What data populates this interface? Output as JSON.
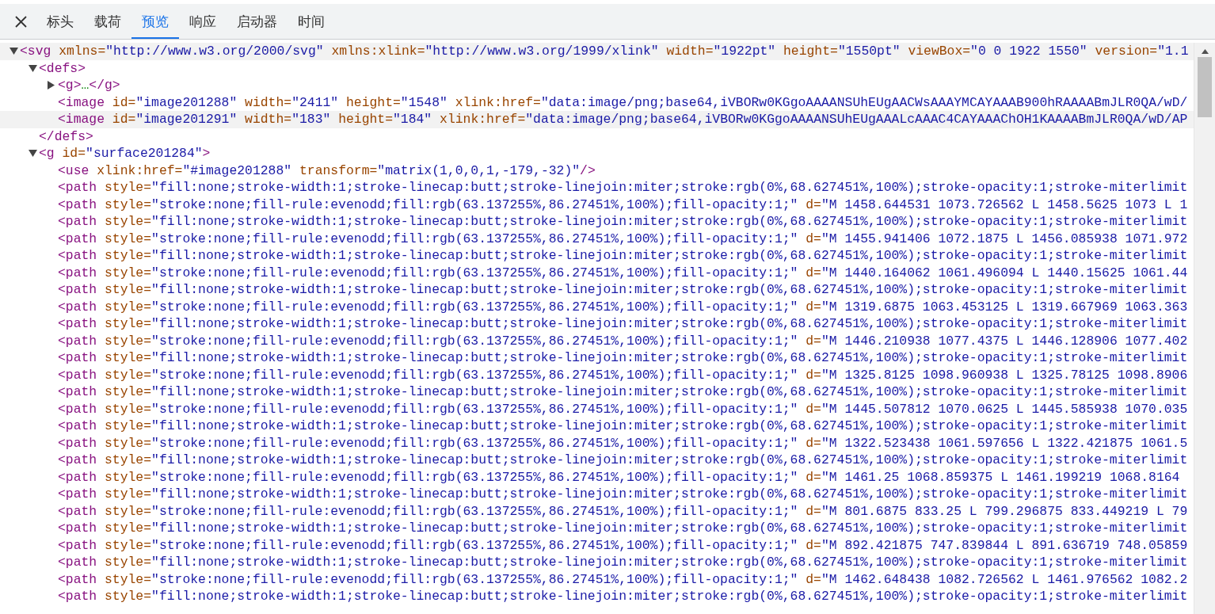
{
  "tabs": [
    {
      "label": "标头",
      "selected": false
    },
    {
      "label": "载荷",
      "selected": false
    },
    {
      "label": "预览",
      "selected": true
    },
    {
      "label": "响应",
      "selected": false
    },
    {
      "label": "启动器",
      "selected": false
    },
    {
      "label": "时间",
      "selected": false
    }
  ],
  "tree": [
    {
      "expanded": true,
      "highlighted": true,
      "tokens": [
        {
          "kind": "tag",
          "text": "<svg"
        },
        {
          "kind": "attr",
          "text": " xmlns="
        },
        {
          "kind": "value",
          "text": "\"http://www.w3.org/2000/svg\""
        },
        {
          "kind": "attr",
          "text": " xmlns:xlink="
        },
        {
          "kind": "value",
          "text": "\"http://www.w3.org/1999/xlink\""
        },
        {
          "kind": "attr",
          "text": " width="
        },
        {
          "kind": "value",
          "text": "\"1922pt\""
        },
        {
          "kind": "attr",
          "text": " height="
        },
        {
          "kind": "value",
          "text": "\"1550pt\""
        },
        {
          "kind": "attr",
          "text": " viewBox="
        },
        {
          "kind": "value",
          "text": "\"0 0 1922 1550\""
        },
        {
          "kind": "attr",
          "text": " version="
        },
        {
          "kind": "value",
          "text": "\"1.1"
        }
      ],
      "children": [
        {
          "expanded": true,
          "highlighted": false,
          "tokens": [
            {
              "kind": "tag",
              "text": "<defs>"
            }
          ],
          "close": [
            {
              "kind": "tag",
              "text": "</defs>"
            }
          ],
          "children": [
            {
              "expanded": false,
              "highlighted": false,
              "tokens": [
                {
                  "kind": "tag",
                  "text": "<g>"
                },
                {
                  "kind": "ellipsis",
                  "text": "…"
                },
                {
                  "kind": "tag",
                  "text": "</g>"
                }
              ]
            },
            {
              "highlighted": false,
              "tokens": [
                {
                  "kind": "tag",
                  "text": "<image"
                },
                {
                  "kind": "attr",
                  "text": " id="
                },
                {
                  "kind": "value",
                  "text": "\"image201288\""
                },
                {
                  "kind": "attr",
                  "text": " width="
                },
                {
                  "kind": "value",
                  "text": "\"2411\""
                },
                {
                  "kind": "attr",
                  "text": " height="
                },
                {
                  "kind": "value",
                  "text": "\"1548\""
                },
                {
                  "kind": "attr",
                  "text": " xlink:href="
                },
                {
                  "kind": "value",
                  "text": "\"data:image/png;base64,iVBORw0KGgoAAAANSUhEUgAACWsAAAYMCAYAAAB900hRAAAABmJLR0QA/wD/"
                }
              ]
            },
            {
              "highlighted": true,
              "tokens": [
                {
                  "kind": "tag",
                  "text": "<image"
                },
                {
                  "kind": "attr",
                  "text": " id="
                },
                {
                  "kind": "value",
                  "text": "\"image201291\""
                },
                {
                  "kind": "attr",
                  "text": " width="
                },
                {
                  "kind": "value",
                  "text": "\"183\""
                },
                {
                  "kind": "attr",
                  "text": " height="
                },
                {
                  "kind": "value",
                  "text": "\"184\""
                },
                {
                  "kind": "attr",
                  "text": " xlink:href="
                },
                {
                  "kind": "value",
                  "text": "\"data:image/png;base64,iVBORw0KGgoAAAANSUhEUgAAALcAAAC4CAYAAAChOH1KAAAABmJLR0QA/wD/AP"
                }
              ]
            }
          ]
        },
        {
          "expanded": true,
          "highlighted": false,
          "tokens": [
            {
              "kind": "tag",
              "text": "<g"
            },
            {
              "kind": "attr",
              "text": " id="
            },
            {
              "kind": "value",
              "text": "\"surface201284\""
            },
            {
              "kind": "tag",
              "text": ">"
            }
          ],
          "children": [
            {
              "highlighted": false,
              "tokens": [
                {
                  "kind": "tag",
                  "text": "<use"
                },
                {
                  "kind": "attr",
                  "text": " xlink:href="
                },
                {
                  "kind": "value",
                  "text": "\"#image201288\""
                },
                {
                  "kind": "attr",
                  "text": " transform="
                },
                {
                  "kind": "value",
                  "text": "\"matrix(1,0,0,1,-179,-32)\""
                },
                {
                  "kind": "tag",
                  "text": "/>"
                }
              ]
            },
            {
              "highlighted": false,
              "tokens": [
                {
                  "kind": "tag",
                  "text": "<path"
                },
                {
                  "kind": "attr",
                  "text": " style="
                },
                {
                  "kind": "value",
                  "text": "\"fill:none;stroke-width:1;stroke-linecap:butt;stroke-linejoin:miter;stroke:rgb(0%,68.627451%,100%);stroke-opacity:1;stroke-miterlimit"
                }
              ]
            },
            {
              "highlighted": false,
              "tokens": [
                {
                  "kind": "tag",
                  "text": "<path"
                },
                {
                  "kind": "attr",
                  "text": " style="
                },
                {
                  "kind": "value",
                  "text": "\"stroke:none;fill-rule:evenodd;fill:rgb(63.137255%,86.27451%,100%);fill-opacity:1;\""
                },
                {
                  "kind": "attr",
                  "text": " d="
                },
                {
                  "kind": "value",
                  "text": "\"M 1458.644531 1073.726562 L 1458.5625 1073 L 1"
                }
              ]
            },
            {
              "highlighted": false,
              "tokens": [
                {
                  "kind": "tag",
                  "text": "<path"
                },
                {
                  "kind": "attr",
                  "text": " style="
                },
                {
                  "kind": "value",
                  "text": "\"fill:none;stroke-width:1;stroke-linecap:butt;stroke-linejoin:miter;stroke:rgb(0%,68.627451%,100%);stroke-opacity:1;stroke-miterlimit"
                }
              ]
            },
            {
              "highlighted": false,
              "tokens": [
                {
                  "kind": "tag",
                  "text": "<path"
                },
                {
                  "kind": "attr",
                  "text": " style="
                },
                {
                  "kind": "value",
                  "text": "\"stroke:none;fill-rule:evenodd;fill:rgb(63.137255%,86.27451%,100%);fill-opacity:1;\""
                },
                {
                  "kind": "attr",
                  "text": " d="
                },
                {
                  "kind": "value",
                  "text": "\"M 1455.941406 1072.1875 L 1456.085938 1071.972"
                }
              ]
            },
            {
              "highlighted": false,
              "tokens": [
                {
                  "kind": "tag",
                  "text": "<path"
                },
                {
                  "kind": "attr",
                  "text": " style="
                },
                {
                  "kind": "value",
                  "text": "\"fill:none;stroke-width:1;stroke-linecap:butt;stroke-linejoin:miter;stroke:rgb(0%,68.627451%,100%);stroke-opacity:1;stroke-miterlimit"
                }
              ]
            },
            {
              "highlighted": false,
              "tokens": [
                {
                  "kind": "tag",
                  "text": "<path"
                },
                {
                  "kind": "attr",
                  "text": " style="
                },
                {
                  "kind": "value",
                  "text": "\"stroke:none;fill-rule:evenodd;fill:rgb(63.137255%,86.27451%,100%);fill-opacity:1;\""
                },
                {
                  "kind": "attr",
                  "text": " d="
                },
                {
                  "kind": "value",
                  "text": "\"M 1440.164062 1061.496094 L 1440.15625 1061.44"
                }
              ]
            },
            {
              "highlighted": false,
              "tokens": [
                {
                  "kind": "tag",
                  "text": "<path"
                },
                {
                  "kind": "attr",
                  "text": " style="
                },
                {
                  "kind": "value",
                  "text": "\"fill:none;stroke-width:1;stroke-linecap:butt;stroke-linejoin:miter;stroke:rgb(0%,68.627451%,100%);stroke-opacity:1;stroke-miterlimit"
                }
              ]
            },
            {
              "highlighted": false,
              "tokens": [
                {
                  "kind": "tag",
                  "text": "<path"
                },
                {
                  "kind": "attr",
                  "text": " style="
                },
                {
                  "kind": "value",
                  "text": "\"stroke:none;fill-rule:evenodd;fill:rgb(63.137255%,86.27451%,100%);fill-opacity:1;\""
                },
                {
                  "kind": "attr",
                  "text": " d="
                },
                {
                  "kind": "value",
                  "text": "\"M 1319.6875 1063.453125 L 1319.667969 1063.363"
                }
              ]
            },
            {
              "highlighted": false,
              "tokens": [
                {
                  "kind": "tag",
                  "text": "<path"
                },
                {
                  "kind": "attr",
                  "text": " style="
                },
                {
                  "kind": "value",
                  "text": "\"fill:none;stroke-width:1;stroke-linecap:butt;stroke-linejoin:miter;stroke:rgb(0%,68.627451%,100%);stroke-opacity:1;stroke-miterlimit"
                }
              ]
            },
            {
              "highlighted": false,
              "tokens": [
                {
                  "kind": "tag",
                  "text": "<path"
                },
                {
                  "kind": "attr",
                  "text": " style="
                },
                {
                  "kind": "value",
                  "text": "\"stroke:none;fill-rule:evenodd;fill:rgb(63.137255%,86.27451%,100%);fill-opacity:1;\""
                },
                {
                  "kind": "attr",
                  "text": " d="
                },
                {
                  "kind": "value",
                  "text": "\"M 1446.210938 1077.4375 L 1446.128906 1077.402"
                }
              ]
            },
            {
              "highlighted": false,
              "tokens": [
                {
                  "kind": "tag",
                  "text": "<path"
                },
                {
                  "kind": "attr",
                  "text": " style="
                },
                {
                  "kind": "value",
                  "text": "\"fill:none;stroke-width:1;stroke-linecap:butt;stroke-linejoin:miter;stroke:rgb(0%,68.627451%,100%);stroke-opacity:1;stroke-miterlimit"
                }
              ]
            },
            {
              "highlighted": false,
              "tokens": [
                {
                  "kind": "tag",
                  "text": "<path"
                },
                {
                  "kind": "attr",
                  "text": " style="
                },
                {
                  "kind": "value",
                  "text": "\"stroke:none;fill-rule:evenodd;fill:rgb(63.137255%,86.27451%,100%);fill-opacity:1;\""
                },
                {
                  "kind": "attr",
                  "text": " d="
                },
                {
                  "kind": "value",
                  "text": "\"M 1325.8125 1098.960938 L 1325.78125 1098.8906"
                }
              ]
            },
            {
              "highlighted": false,
              "tokens": [
                {
                  "kind": "tag",
                  "text": "<path"
                },
                {
                  "kind": "attr",
                  "text": " style="
                },
                {
                  "kind": "value",
                  "text": "\"fill:none;stroke-width:1;stroke-linecap:butt;stroke-linejoin:miter;stroke:rgb(0%,68.627451%,100%);stroke-opacity:1;stroke-miterlimit"
                }
              ]
            },
            {
              "highlighted": false,
              "tokens": [
                {
                  "kind": "tag",
                  "text": "<path"
                },
                {
                  "kind": "attr",
                  "text": " style="
                },
                {
                  "kind": "value",
                  "text": "\"stroke:none;fill-rule:evenodd;fill:rgb(63.137255%,86.27451%,100%);fill-opacity:1;\""
                },
                {
                  "kind": "attr",
                  "text": " d="
                },
                {
                  "kind": "value",
                  "text": "\"M 1445.507812 1070.0625 L 1445.585938 1070.035"
                }
              ]
            },
            {
              "highlighted": false,
              "tokens": [
                {
                  "kind": "tag",
                  "text": "<path"
                },
                {
                  "kind": "attr",
                  "text": " style="
                },
                {
                  "kind": "value",
                  "text": "\"fill:none;stroke-width:1;stroke-linecap:butt;stroke-linejoin:miter;stroke:rgb(0%,68.627451%,100%);stroke-opacity:1;stroke-miterlimit"
                }
              ]
            },
            {
              "highlighted": false,
              "tokens": [
                {
                  "kind": "tag",
                  "text": "<path"
                },
                {
                  "kind": "attr",
                  "text": " style="
                },
                {
                  "kind": "value",
                  "text": "\"stroke:none;fill-rule:evenodd;fill:rgb(63.137255%,86.27451%,100%);fill-opacity:1;\""
                },
                {
                  "kind": "attr",
                  "text": " d="
                },
                {
                  "kind": "value",
                  "text": "\"M 1322.523438 1061.597656 L 1322.421875 1061.5"
                }
              ]
            },
            {
              "highlighted": false,
              "tokens": [
                {
                  "kind": "tag",
                  "text": "<path"
                },
                {
                  "kind": "attr",
                  "text": " style="
                },
                {
                  "kind": "value",
                  "text": "\"fill:none;stroke-width:1;stroke-linecap:butt;stroke-linejoin:miter;stroke:rgb(0%,68.627451%,100%);stroke-opacity:1;stroke-miterlimit"
                }
              ]
            },
            {
              "highlighted": false,
              "tokens": [
                {
                  "kind": "tag",
                  "text": "<path"
                },
                {
                  "kind": "attr",
                  "text": " style="
                },
                {
                  "kind": "value",
                  "text": "\"stroke:none;fill-rule:evenodd;fill:rgb(63.137255%,86.27451%,100%);fill-opacity:1;\""
                },
                {
                  "kind": "attr",
                  "text": " d="
                },
                {
                  "kind": "value",
                  "text": "\"M 1461.25 1068.859375 L 1461.199219 1068.8164"
                }
              ]
            },
            {
              "highlighted": false,
              "tokens": [
                {
                  "kind": "tag",
                  "text": "<path"
                },
                {
                  "kind": "attr",
                  "text": " style="
                },
                {
                  "kind": "value",
                  "text": "\"fill:none;stroke-width:1;stroke-linecap:butt;stroke-linejoin:miter;stroke:rgb(0%,68.627451%,100%);stroke-opacity:1;stroke-miterlimit"
                }
              ]
            },
            {
              "highlighted": false,
              "tokens": [
                {
                  "kind": "tag",
                  "text": "<path"
                },
                {
                  "kind": "attr",
                  "text": " style="
                },
                {
                  "kind": "value",
                  "text": "\"stroke:none;fill-rule:evenodd;fill:rgb(63.137255%,86.27451%,100%);fill-opacity:1;\""
                },
                {
                  "kind": "attr",
                  "text": " d="
                },
                {
                  "kind": "value",
                  "text": "\"M 801.6875 833.25 L 799.296875 833.449219 L 79"
                }
              ]
            },
            {
              "highlighted": false,
              "tokens": [
                {
                  "kind": "tag",
                  "text": "<path"
                },
                {
                  "kind": "attr",
                  "text": " style="
                },
                {
                  "kind": "value",
                  "text": "\"fill:none;stroke-width:1;stroke-linecap:butt;stroke-linejoin:miter;stroke:rgb(0%,68.627451%,100%);stroke-opacity:1;stroke-miterlimit"
                }
              ]
            },
            {
              "highlighted": false,
              "tokens": [
                {
                  "kind": "tag",
                  "text": "<path"
                },
                {
                  "kind": "attr",
                  "text": " style="
                },
                {
                  "kind": "value",
                  "text": "\"stroke:none;fill-rule:evenodd;fill:rgb(63.137255%,86.27451%,100%);fill-opacity:1;\""
                },
                {
                  "kind": "attr",
                  "text": " d="
                },
                {
                  "kind": "value",
                  "text": "\"M 892.421875 747.839844 L 891.636719 748.05859"
                }
              ]
            },
            {
              "highlighted": false,
              "tokens": [
                {
                  "kind": "tag",
                  "text": "<path"
                },
                {
                  "kind": "attr",
                  "text": " style="
                },
                {
                  "kind": "value",
                  "text": "\"fill:none;stroke-width:1;stroke-linecap:butt;stroke-linejoin:miter;stroke:rgb(0%,68.627451%,100%);stroke-opacity:1;stroke-miterlimit"
                }
              ]
            },
            {
              "highlighted": false,
              "tokens": [
                {
                  "kind": "tag",
                  "text": "<path"
                },
                {
                  "kind": "attr",
                  "text": " style="
                },
                {
                  "kind": "value",
                  "text": "\"stroke:none;fill-rule:evenodd;fill:rgb(63.137255%,86.27451%,100%);fill-opacity:1;\""
                },
                {
                  "kind": "attr",
                  "text": " d="
                },
                {
                  "kind": "value",
                  "text": "\"M 1462.648438 1082.726562 L 1461.976562 1082.2"
                }
              ]
            },
            {
              "highlighted": false,
              "tokens": [
                {
                  "kind": "tag",
                  "text": "<path"
                },
                {
                  "kind": "attr",
                  "text": " style="
                },
                {
                  "kind": "value",
                  "text": "\"fill:none;stroke-width:1;stroke-linecap:butt;stroke-linejoin:miter;stroke:rgb(0%,68.627451%,100%);stroke-opacity:1;stroke-miterlimit"
                }
              ]
            }
          ]
        }
      ]
    }
  ]
}
